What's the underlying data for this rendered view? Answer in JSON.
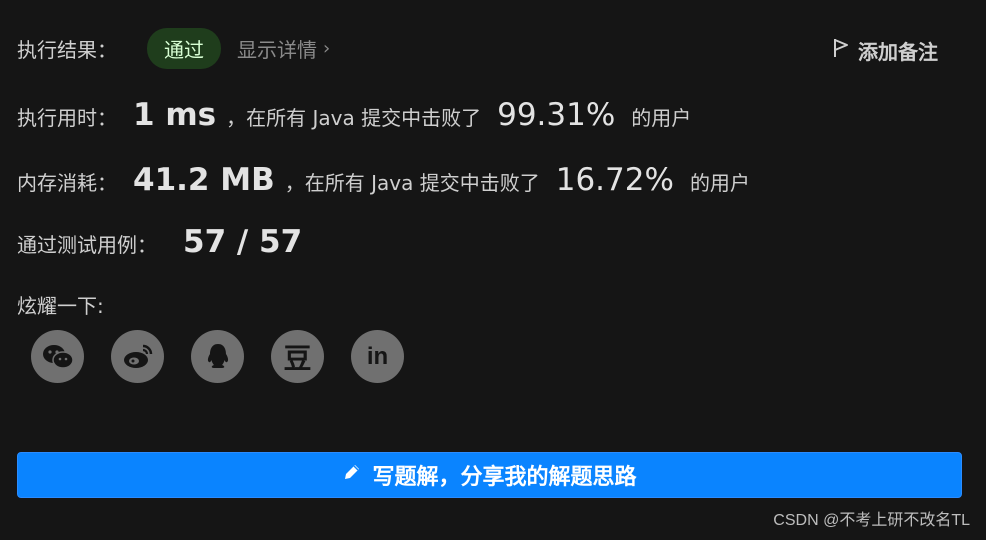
{
  "result": {
    "label": "执行结果：",
    "status": "通过",
    "details": "显示详情",
    "add_note": "添加备注"
  },
  "time": {
    "label": "执行用时：",
    "value": "1 ms",
    "middle": "，在所有 Java 提交中击败了",
    "percent": "99.31%",
    "suffix": "的用户"
  },
  "memory": {
    "label": "内存消耗：",
    "value": "41.2 MB",
    "middle": "，在所有 Java 提交中击败了",
    "percent": "16.72%",
    "suffix": "的用户"
  },
  "tests": {
    "label": "通过测试用例：",
    "value": "57 / 57"
  },
  "share": {
    "label": "炫耀一下:",
    "icons": [
      "wechat-icon",
      "weibo-icon",
      "qq-icon",
      "douban-icon",
      "linkedin-icon"
    ],
    "douban_glyph": "豆",
    "linkedin_glyph": "in"
  },
  "cta": {
    "label": "写题解，分享我的解题思路",
    "color": "#0a84ff"
  },
  "watermark": "CSDN @不考上研不改名TL"
}
